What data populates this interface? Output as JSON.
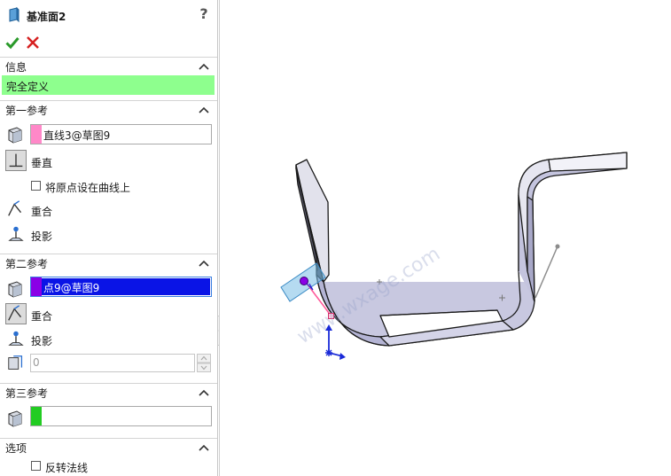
{
  "feature": {
    "title": "基准面2",
    "help_symbol": "?"
  },
  "sections": {
    "info": {
      "label": "信息",
      "status": "完全定义",
      "status_color": "#8eff8e"
    },
    "first_reference": {
      "label": "第一参考",
      "selection": "直线3@草图9",
      "swatch_color": "#ff88c8",
      "options": {
        "perpendicular": "垂直",
        "origin_on_curve": "将原点设在曲线上",
        "coincident": "重合",
        "projection": "投影"
      }
    },
    "second_reference": {
      "label": "第二参考",
      "selection": "点9@草图9",
      "swatch_color": "#8a00e6",
      "highlight_color": "#0a14e6",
      "options": {
        "coincident": "重合",
        "projection": "投影"
      },
      "spin_value": "0"
    },
    "third_reference": {
      "label": "第三参考",
      "selection": "",
      "swatch_color": "#22cc22"
    },
    "options": {
      "label": "选项",
      "flip_normal": "反转法线"
    }
  },
  "icons": {
    "title": "plane-feature-icon",
    "ok": "green-check-icon",
    "cancel": "red-x-icon",
    "collapse": "chevron-up-icon",
    "selection": "cube-face-icon",
    "perpendicular": "perpendicular-icon",
    "coincident": "coincident-icon",
    "projection": "projection-icon",
    "spin": "spinner-arrows-icon"
  },
  "viewport": {
    "watermark": "www.wxage.com"
  }
}
